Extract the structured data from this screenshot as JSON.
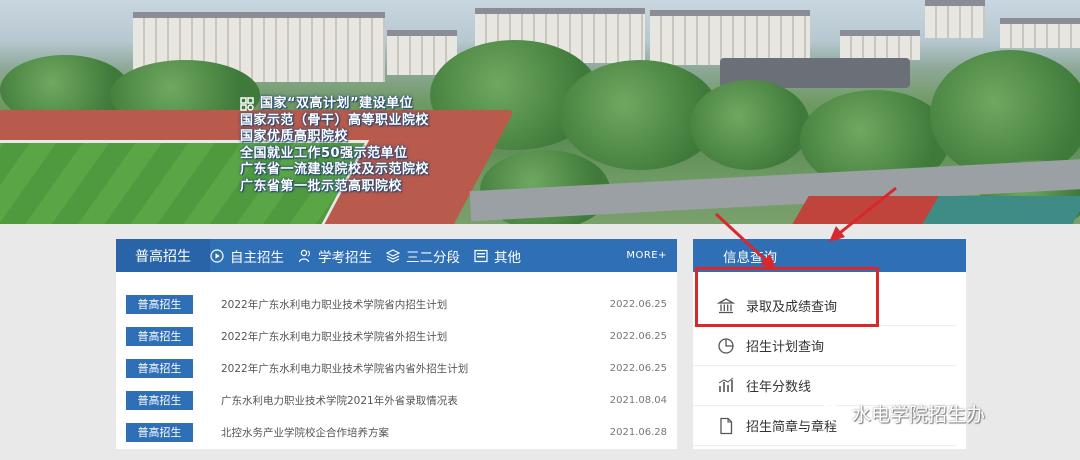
{
  "banner": {
    "lines": [
      "国家“双高计划”建设单位",
      "国家示范（骨干）高等职业院校",
      "国家优质高职院校",
      "全国就业工作50强示范单位",
      "广东省一流建设院校及示范院校",
      "广东省第一批示范高职院校"
    ]
  },
  "news": {
    "tabs": [
      {
        "label": "普高招生",
        "icon": "none"
      },
      {
        "label": "自主招生",
        "icon": "play-circle-icon"
      },
      {
        "label": "学考招生",
        "icon": "users-icon"
      },
      {
        "label": "三二分段",
        "icon": "layers-icon"
      },
      {
        "label": "其他",
        "icon": "image-icon"
      }
    ],
    "more_label": "MORE+",
    "items": [
      {
        "tag": "普高招生",
        "title": "2022年广东水利电力职业技术学院省内招生计划",
        "date": "2022.06.25"
      },
      {
        "tag": "普高招生",
        "title": "2022年广东水利电力职业技术学院省外招生计划",
        "date": "2022.06.25"
      },
      {
        "tag": "普高招生",
        "title": "2022年广东水利电力职业技术学院省内省外招生计划",
        "date": "2022.06.25"
      },
      {
        "tag": "普高招生",
        "title": "广东水利电力职业技术学院2021年外省录取情况表",
        "date": "2021.08.04"
      },
      {
        "tag": "普高招生",
        "title": "北控水务产业学院校企合作培养方案",
        "date": "2021.06.28"
      }
    ]
  },
  "info": {
    "title": "信息查询",
    "items": [
      {
        "label": "录取及成绩查询",
        "icon": "bank-icon"
      },
      {
        "label": "招生计划查询",
        "icon": "pie-chart-icon"
      },
      {
        "label": "往年分数线",
        "icon": "bar-chart-icon"
      },
      {
        "label": "招生简章与章程",
        "icon": "document-icon"
      }
    ]
  },
  "watermark": {
    "text": "水电学院招生办",
    "icon": "wechat-icon"
  },
  "colors": {
    "primary": "#2f6fb6",
    "highlight": "#d8282c",
    "background": "#e9e9e9"
  }
}
